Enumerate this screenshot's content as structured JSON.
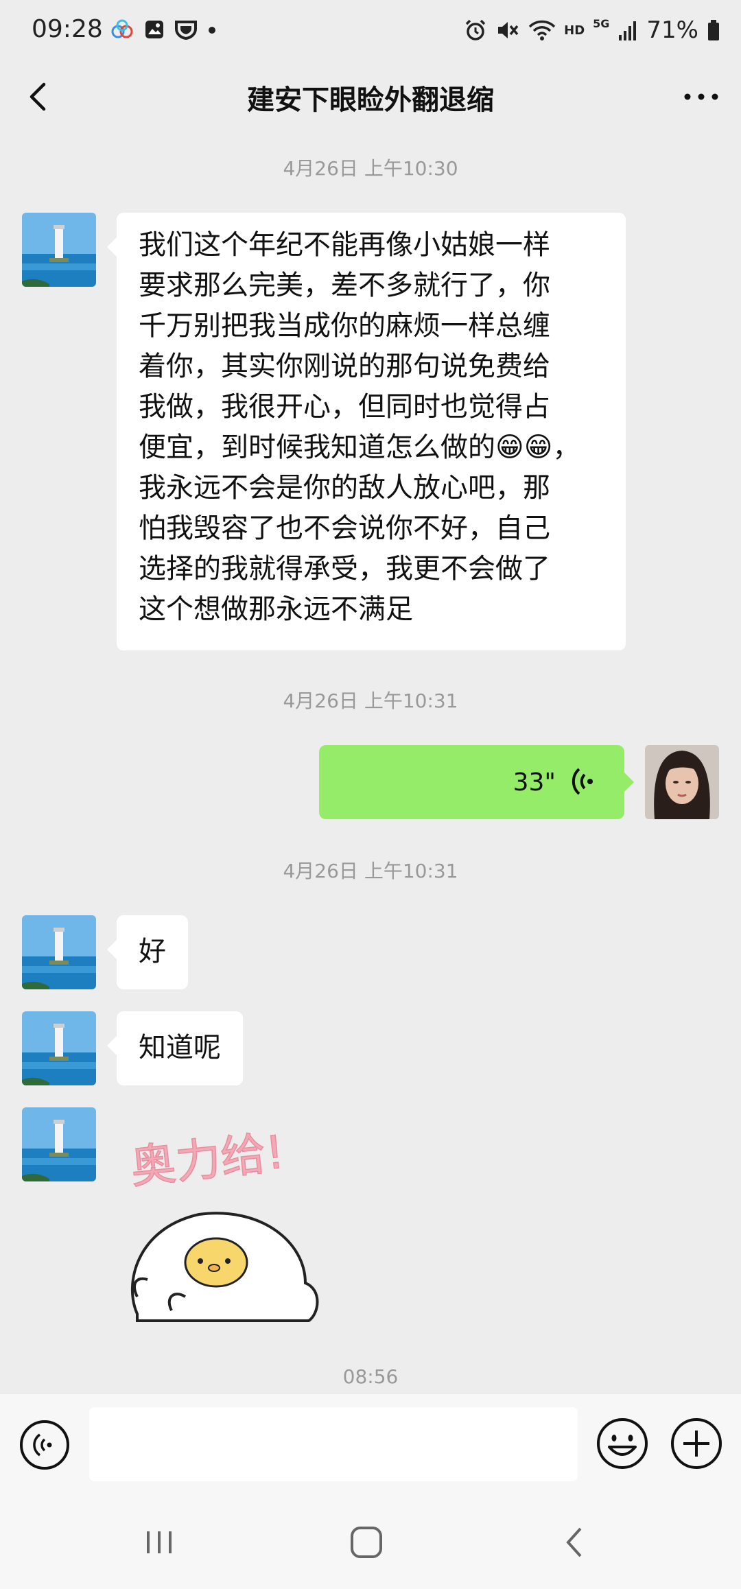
{
  "status_bar": {
    "time": "09:28",
    "battery": "71%",
    "network_hd": "HD",
    "network_5g": "5G",
    "icons": [
      "baidu-cloud-icon",
      "gallery-icon",
      "shield-icon",
      "dot-icon",
      "alarm-icon",
      "mute-icon",
      "wifi-icon",
      "signal-icon",
      "battery-icon"
    ]
  },
  "nav": {
    "title": "建安下眼睑外翻退缩"
  },
  "messages": {
    "ts1": "4月26日 上午10:30",
    "msg1_lines": [
      "我们这个年纪不能再像小姑娘一样",
      "要求那么完美，差不多就行了，你",
      "千万别把我当成你的麻烦一样总缠",
      "着你，其实你刚说的那句说免费给",
      "我做，我很开心，但同时也觉得占",
      "便宜，到时候我知道怎么做的😁😁，",
      "我永远不会是你的敌人放心吧，那",
      "怕我毁容了也不会说你不好，自己",
      "选择的我就得承受，我更不会做了",
      "这个想做那永远不满足"
    ],
    "ts2": "4月26日 上午10:31",
    "voice_duration": "33\"",
    "ts3": "4月26日 上午10:31",
    "msg2": "好",
    "msg3": "知道呢",
    "sticker_text": "奥力给!",
    "ts4": "08:56"
  },
  "colors": {
    "background": "#ededed",
    "bubble_in": "#ffffff",
    "bubble_out": "#95ec69",
    "timestamp": "#999999"
  }
}
